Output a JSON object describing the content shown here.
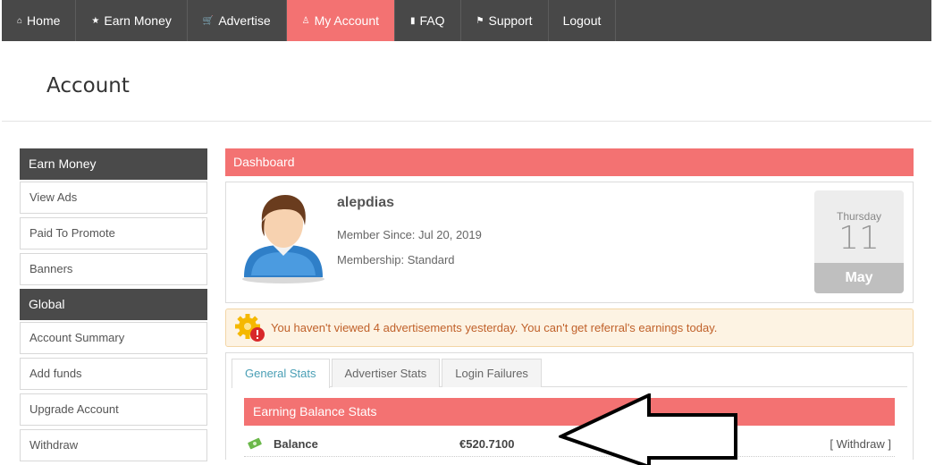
{
  "nav": {
    "items": [
      {
        "label": "Home",
        "icon": "home-icon",
        "glyph": "⌂"
      },
      {
        "label": "Earn Money",
        "icon": "star-icon",
        "glyph": "★"
      },
      {
        "label": "Advertise",
        "icon": "cart-icon",
        "glyph": "🛒"
      },
      {
        "label": "My Account",
        "icon": "user-icon",
        "glyph": "♙"
      },
      {
        "label": "FAQ",
        "icon": "book-icon",
        "glyph": "▮"
      },
      {
        "label": "Support",
        "icon": "flag-icon",
        "glyph": "⚑"
      },
      {
        "label": "Logout",
        "icon": "",
        "glyph": ""
      }
    ],
    "active_color": "#f37272",
    "bg_color": "#484848"
  },
  "page": {
    "title": "Account"
  },
  "sidebar": {
    "section1": "Earn Money",
    "section1_items": [
      "View Ads",
      "Paid To Promote",
      "Banners"
    ],
    "section2": "Global",
    "section2_items": [
      "Account Summary",
      "Add funds",
      "Upgrade Account",
      "Withdraw"
    ]
  },
  "dashboard": {
    "title": "Dashboard",
    "username": "alepdias",
    "member_since": "Member Since: Jul 20, 2019",
    "membership": "Membership: Standard",
    "calendar": {
      "weekday": "Thursday",
      "day": "11",
      "month": "May"
    }
  },
  "alert": {
    "text": "You haven't viewed 4 advertisements yesterday. You can't get referral's earnings today."
  },
  "tabs": [
    "General Stats",
    "Advertiser Stats",
    "Login Failures"
  ],
  "stats": {
    "header": "Earning Balance Stats",
    "balance_label": "Balance",
    "balance_value": "€520.7100",
    "withdraw_link": "[ Withdraw ]"
  }
}
